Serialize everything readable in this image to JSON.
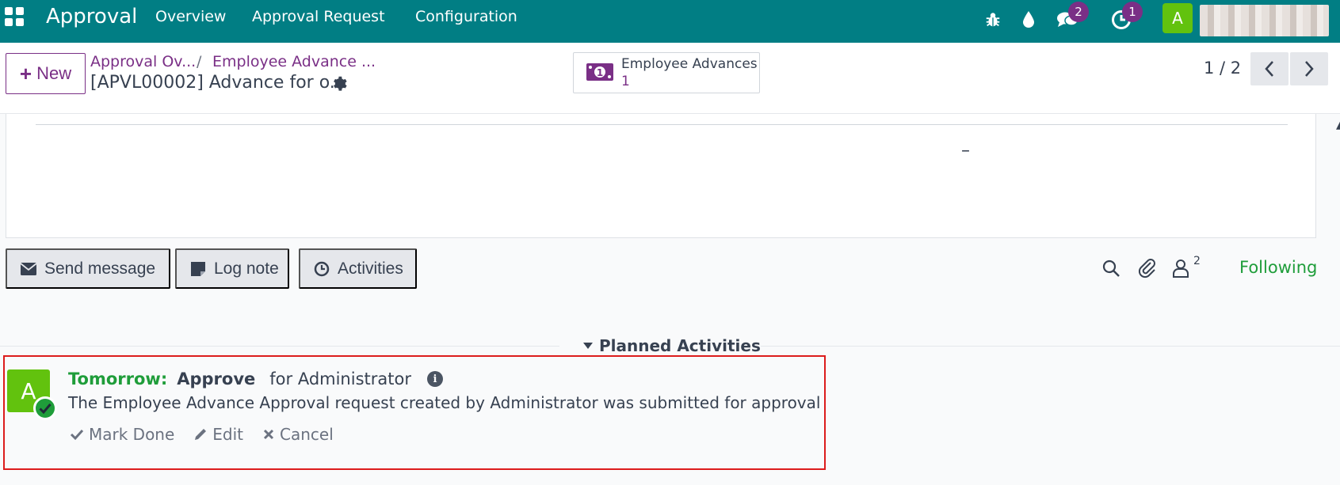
{
  "navbar": {
    "brand": "Approval",
    "menu": [
      "Overview",
      "Approval Request",
      "Configuration"
    ],
    "messages_badge": "2",
    "activities_badge": "1",
    "user_initial": "A"
  },
  "control_panel": {
    "new_label": "New",
    "breadcrumbs": [
      "Approval Ov...",
      "Employee Advance ..."
    ],
    "breadcrumb_separator": "/",
    "record_title": "[APVL00002] Advance for o...",
    "smart_button": {
      "label": "Employee Advances",
      "count": "1"
    },
    "pager": "1 / 2"
  },
  "sheet": {
    "dash": "–"
  },
  "chatter": {
    "send_message": "Send message",
    "log_note": "Log note",
    "activities": "Activities",
    "followers_count": "2",
    "following": "Following"
  },
  "planned": {
    "header": "Planned Activities",
    "activity": {
      "avatar_initial": "A",
      "when": "Tomorrow:",
      "type": "Approve",
      "for": "for Administrator",
      "summary": "The Employee Advance Approval request created by Administrator was submitted for approval",
      "mark_done": "Mark Done",
      "edit": "Edit",
      "cancel": "Cancel"
    }
  },
  "colors": {
    "navbar": "#017e84",
    "accent": "#7a2f86",
    "green": "#1f9d3a",
    "avatar": "#62c20e",
    "highlight_border": "#dc1c1c"
  }
}
